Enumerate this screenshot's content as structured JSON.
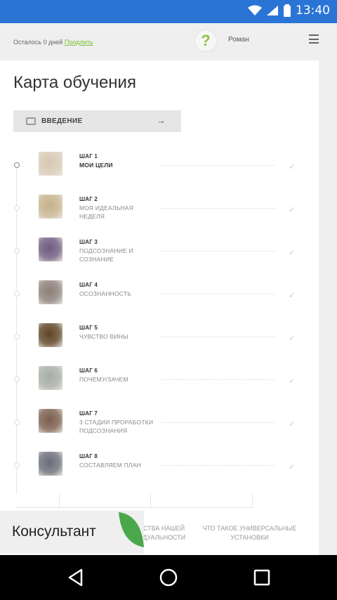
{
  "status_bar": {
    "time": "13:40"
  },
  "topbar": {
    "trial_text": "Осталось 0 дней",
    "extend_link": "Продлить",
    "help_symbol": "?",
    "user_name": "Роман"
  },
  "page": {
    "title": "Карта обучения",
    "intro_button": "ВВЕДЕНИЕ",
    "intro_arrow": "→"
  },
  "steps": [
    {
      "num": "ШАГ 1",
      "title": "МОИ ЦЕЛИ",
      "thumb": "#d6c7b2",
      "active": true
    },
    {
      "num": "ШАГ 2",
      "title": "МОЯ ИДЕАЛЬНАЯ НЕДЕЛЯ",
      "thumb": "#c6b28c",
      "active": false
    },
    {
      "num": "ШАГ 3",
      "title": "ПОДСОЗНАНИЕ И СОЗНАНИЕ",
      "thumb": "#6e5a7e",
      "active": false
    },
    {
      "num": "ШАГ 4",
      "title": "ОСОЗНАННОСТЬ",
      "thumb": "#8c8078",
      "active": false
    },
    {
      "num": "ШАГ 5",
      "title": "ЧУВСТВО ВИНЫ",
      "thumb": "#5e4424",
      "active": false
    },
    {
      "num": "ШАГ 6",
      "title": "ПОЧЕМУ/ЗАЧЕМ",
      "thumb": "#a6aca6",
      "active": false
    },
    {
      "num": "ШАГ 7",
      "title": "3 СТАДИИ ПРОРАБОТКИ ПОДСОЗНАНИЯ",
      "thumb": "#7a5e4c",
      "active": false
    },
    {
      "num": "ШАГ 8",
      "title": "СОСТАВЛЯЕМ ПЛАН",
      "thumb": "#6a6c78",
      "active": false
    }
  ],
  "check_mark": "✓",
  "bottom_links": {
    "link1": "ЕСТВА НАШЕЙ ИДУАЛЬНОСТИ",
    "link2": "ЧТО ТАКОЕ УНИВЕРСАЛЬНЫЕ УСТАНОВКИ"
  },
  "consultant": {
    "label": "Консультант"
  },
  "colors": {
    "status_bar": "#2a74d6",
    "accent_green": "#7bbf2a",
    "leaf_green": "#4aa84a"
  }
}
